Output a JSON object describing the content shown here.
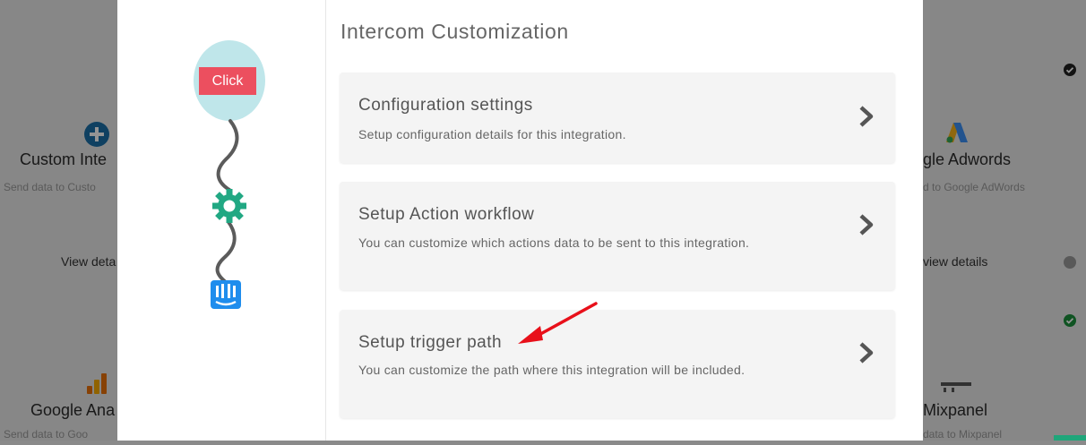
{
  "background": {
    "cards": [
      {
        "title": "Custom Inte",
        "desc": "Send data to Custo",
        "link": "View deta"
      },
      {
        "title": "gle Adwords",
        "desc": "d to Google AdWords",
        "link": "view details"
      },
      {
        "title": "Google Ana",
        "desc": "Send data to Goo",
        "link": ""
      },
      {
        "title": "Mixpanel",
        "desc": "data to Mixpanel",
        "link": ""
      }
    ]
  },
  "modal": {
    "title": "Intercom Customization",
    "flow": {
      "trigger_label": "Click",
      "trigger_color": "#ec4f5f",
      "bubble_color": "#bfe6ea",
      "gear_color": "#21a883",
      "intercom_color": "#1f8ded"
    },
    "options": [
      {
        "title": "Configuration settings",
        "desc": "Setup configuration details for this integration."
      },
      {
        "title": "Setup Action workflow",
        "desc": "You can customize which actions data to be sent to this integration."
      },
      {
        "title": "Setup trigger path",
        "desc": "You can customize the path where this integration will be included."
      }
    ],
    "annotation_color": "#e8101a"
  }
}
